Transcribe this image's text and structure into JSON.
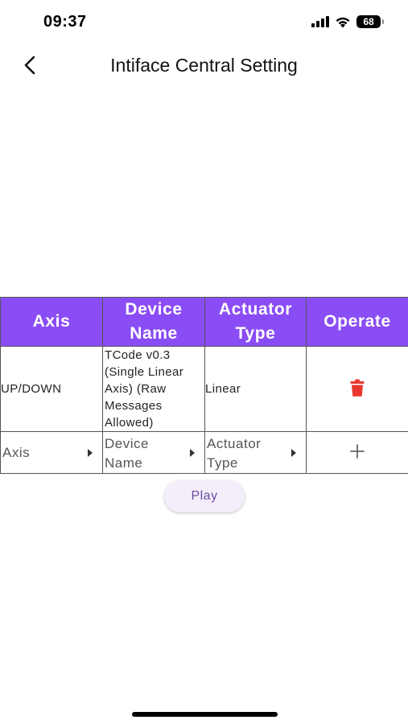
{
  "status_bar": {
    "time": "09:37",
    "battery": "68"
  },
  "header": {
    "title": "Intiface Central Setting",
    "back_icon": "chevron-left-icon"
  },
  "table": {
    "header_color": "#8a4df5",
    "columns": [
      "Axis",
      "Device Name",
      "Actuator Type",
      "Operate"
    ],
    "rows": [
      {
        "axis": "UP/DOWN",
        "device_name": "TCode v0.3 (Single Linear Axis) (Raw Messages Allowed)",
        "actuator_type": "Linear",
        "operate_icon": "trash-icon",
        "operate_color": "#e8382e"
      }
    ],
    "new_row": {
      "axis_placeholder": "Axis",
      "device_placeholder": "Device Name",
      "actuator_placeholder": "Actuator Type",
      "add_icon": "plus-icon"
    }
  },
  "play_button": {
    "label": "Play"
  }
}
